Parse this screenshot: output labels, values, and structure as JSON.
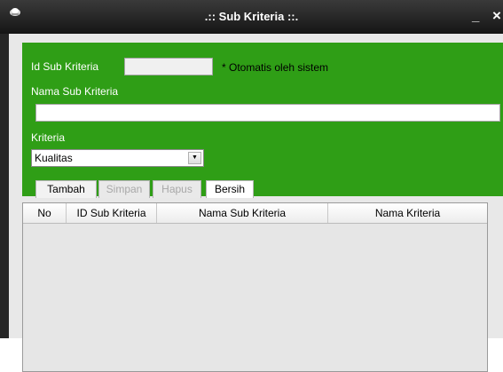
{
  "window": {
    "title": ".:: Sub Kriteria ::.",
    "minimize_glyph": "_",
    "close_glyph": "×"
  },
  "form": {
    "id_label": "Id Sub Kriteria",
    "id_value": "",
    "id_note": "* Otomatis oleh sistem",
    "nama_label": "Nama Sub Kriteria",
    "nama_value": "",
    "kriteria_label": "Kriteria",
    "kriteria_selected": "Kualitas"
  },
  "buttons": {
    "tambah": "Tambah",
    "simpan": "Simpan",
    "hapus": "Hapus",
    "bersih": "Bersih"
  },
  "table": {
    "columns": [
      "No",
      "ID Sub Kriteria",
      "Nama Sub Kriteria",
      "Nama Kriteria"
    ],
    "rows": []
  },
  "colors": {
    "accent": "#2f9e16",
    "titlebar": "#1e1e1e"
  }
}
